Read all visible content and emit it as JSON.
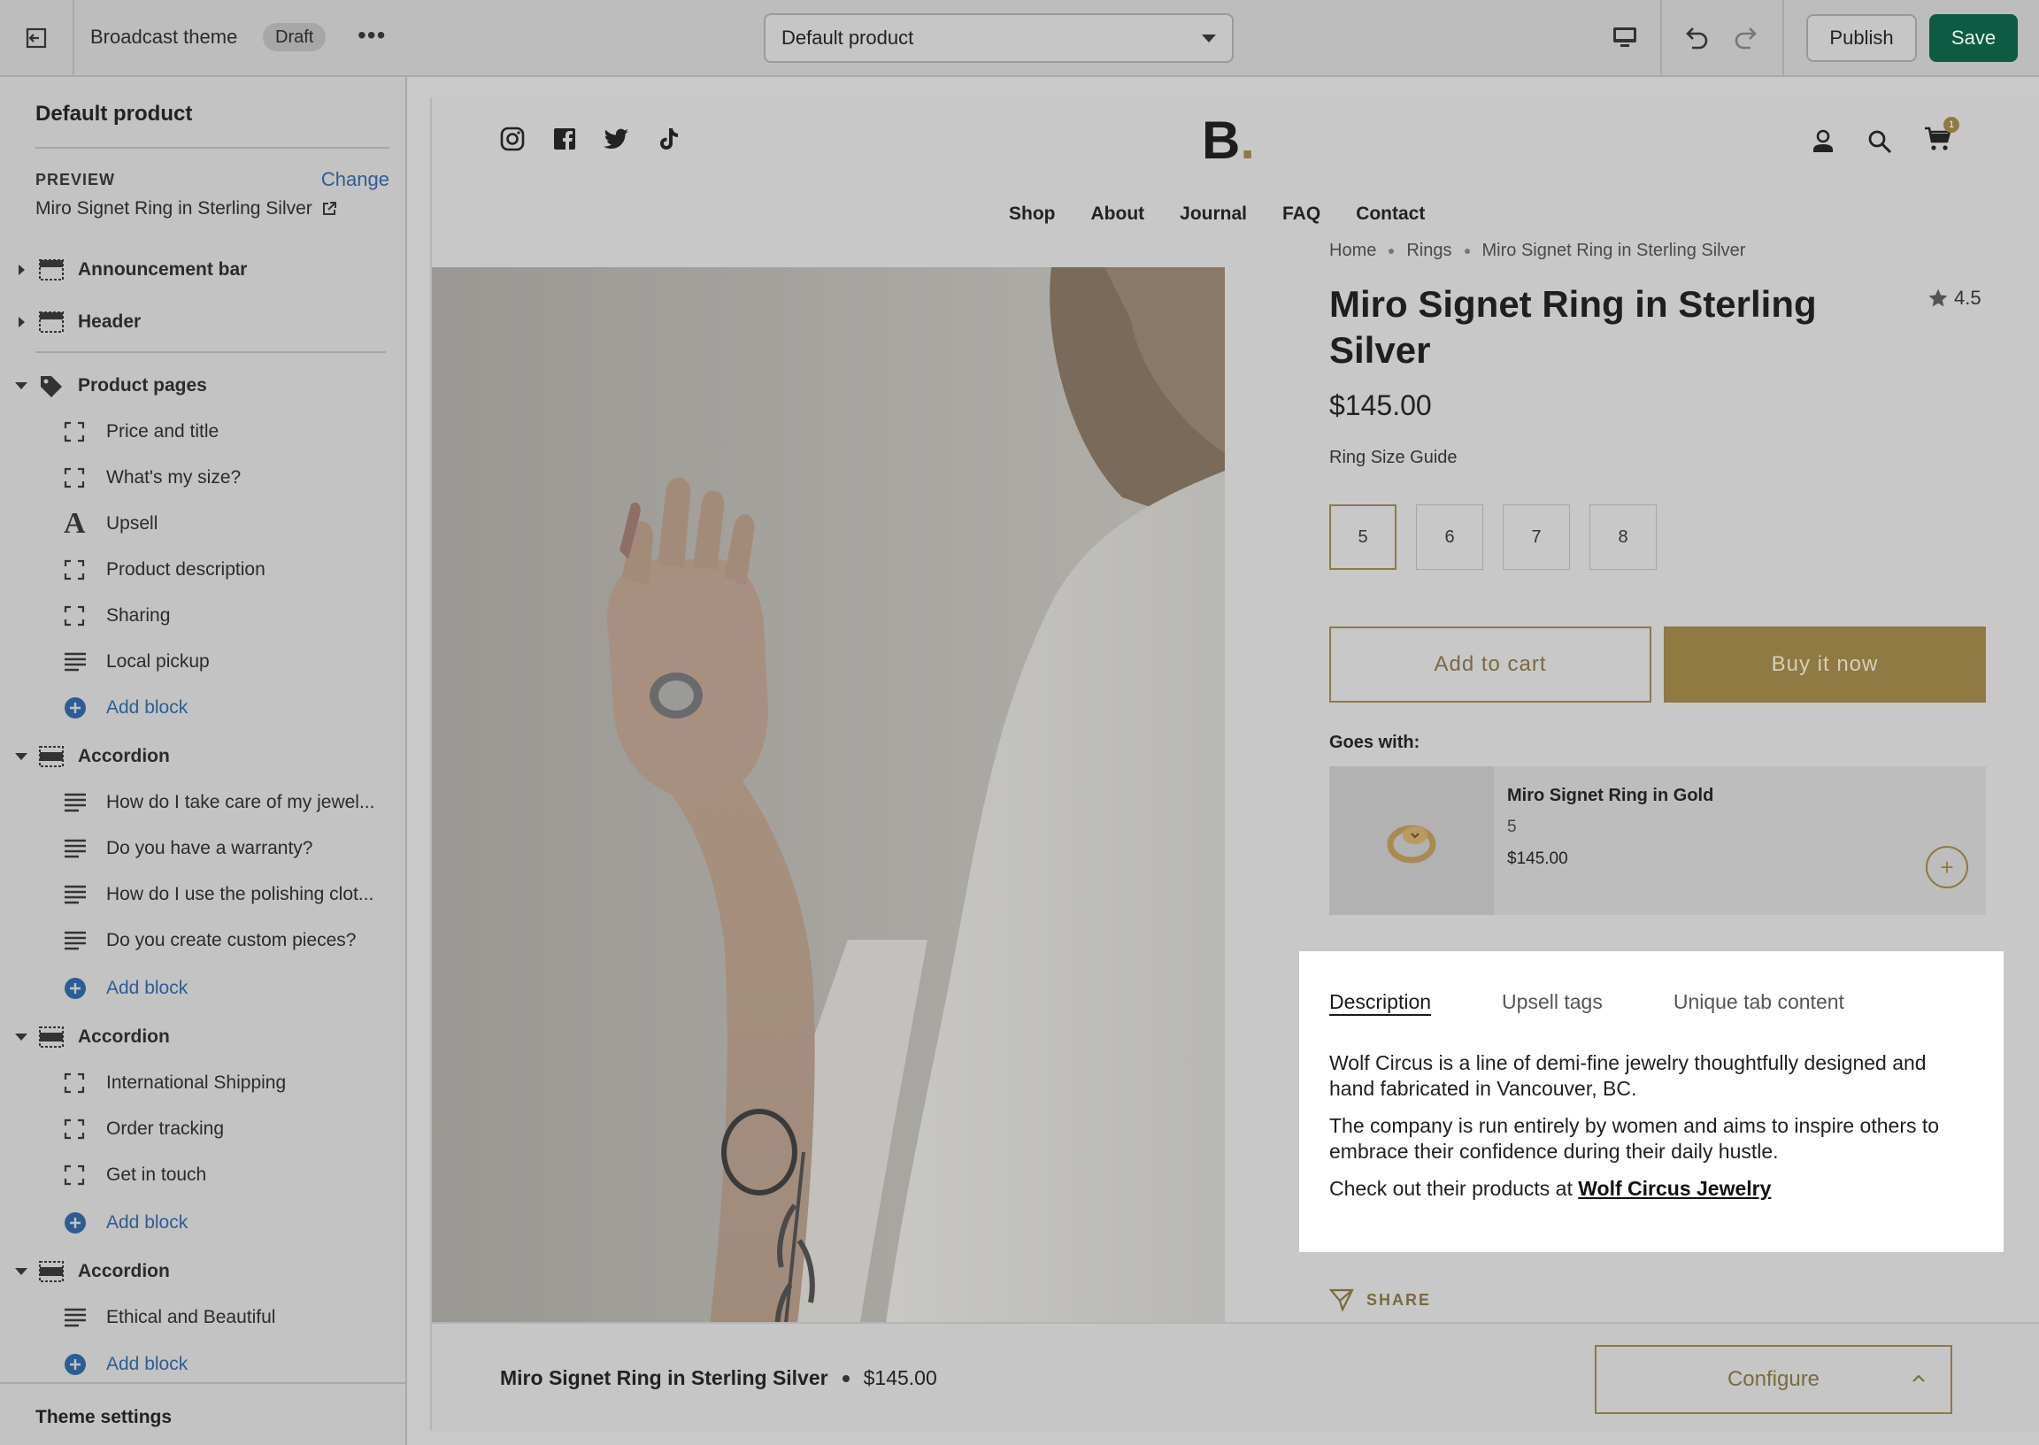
{
  "topbar": {
    "theme_name": "Broadcast theme",
    "status_badge": "Draft",
    "more_label": "•••",
    "template_select": "Default product",
    "publish_label": "Publish",
    "save_label": "Save"
  },
  "sidebar": {
    "title": "Default product",
    "preview_label": "PREVIEW",
    "change_label": "Change",
    "preview_value": "Miro Signet Ring in Sterling Silver",
    "sections": [
      {
        "label": "Announcement bar"
      },
      {
        "label": "Header"
      },
      {
        "label": "Product pages"
      },
      {
        "label": "Accordion"
      },
      {
        "label": "Accordion"
      },
      {
        "label": "Accordion"
      }
    ],
    "product_blocks": [
      "Price and title",
      "What's my size?",
      "Upsell",
      "Product description",
      "Sharing",
      "Local pickup"
    ],
    "accordion1_blocks": [
      "How do I take care of my jewel...",
      "Do you have a warranty?",
      "How do I use the polishing clot...",
      "Do you create custom pieces?"
    ],
    "accordion2_blocks": [
      "International Shipping",
      "Order tracking",
      "Get in touch"
    ],
    "accordion3_blocks": [
      "Ethical and Beautiful"
    ],
    "add_block_label": "Add block",
    "theme_settings_label": "Theme settings"
  },
  "store": {
    "logo": "B",
    "logo_dot": ".",
    "cart_count": "1",
    "nav": [
      "Shop",
      "About",
      "Journal",
      "FAQ",
      "Contact"
    ],
    "breadcrumb": [
      "Home",
      "Rings",
      "Miro Signet Ring in Sterling Silver"
    ],
    "product_title": "Miro Signet Ring in Sterling Silver",
    "rating": "4.5",
    "price": "$145.00",
    "size_guide": "Ring Size Guide",
    "sizes": [
      "5",
      "6",
      "7",
      "8"
    ],
    "selected_size": "5",
    "add_to_cart": "Add to cart",
    "buy_now": "Buy it now",
    "goes_with_label": "Goes with:",
    "upsell": {
      "name": "Miro Signet Ring in Gold",
      "variant": "5",
      "price": "$145.00"
    },
    "tabs": [
      "Description",
      "Upsell tags",
      "Unique tab content"
    ],
    "description": {
      "p1": "Wolf Circus is a line of demi-fine jewelry thoughtfully designed and hand fabricated in Vancouver, BC.",
      "p2": "The company is run entirely by women and aims to inspire others to embrace their confidence during their daily hustle.",
      "p3_prefix": "Check out their products at ",
      "p3_link": "Wolf Circus Jewelry"
    },
    "share_label": "SHARE",
    "sticky": {
      "name": "Miro Signet Ring in Sterling Silver",
      "price": "$145.00",
      "configure": "Configure"
    }
  },
  "colors": {
    "accent": "#8f7a44",
    "save_green": "#0e5b43",
    "link_blue": "#2d5d94"
  }
}
